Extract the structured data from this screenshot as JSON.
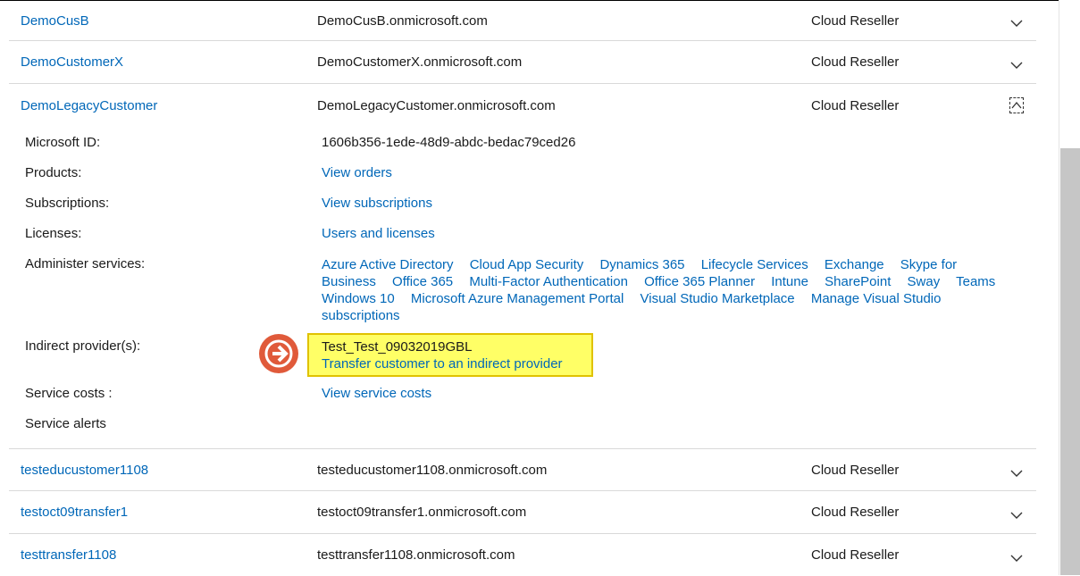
{
  "customers_above": [
    {
      "name": "DemoCusB",
      "domain": "DemoCusB.onmicrosoft.com",
      "relationship": "Cloud Reseller"
    },
    {
      "name": "DemoCustomerX",
      "domain": "DemoCustomerX.onmicrosoft.com",
      "relationship": "Cloud Reseller"
    }
  ],
  "expanded": {
    "name": "DemoLegacyCustomer",
    "domain": "DemoLegacyCustomer.onmicrosoft.com",
    "relationship": "Cloud Reseller",
    "microsoft_id_label": "Microsoft ID:",
    "microsoft_id": "1606b356-1ede-48d9-abdc-bedac79ced26",
    "products_label": "Products:",
    "products_link": "View orders",
    "subscriptions_label": "Subscriptions:",
    "subscriptions_link": "View subscriptions",
    "licenses_label": "Licenses:",
    "licenses_link": "Users and licenses",
    "administer_label": "Administer services:",
    "services": [
      "Azure Active Directory",
      "Cloud App Security",
      "Dynamics 365",
      "Lifecycle Services",
      "Exchange",
      "Skype for Business",
      "Office 365",
      "Multi-Factor Authentication",
      "Office 365 Planner",
      "Intune",
      "SharePoint",
      "Sway",
      "Teams",
      "Windows 10",
      "Microsoft Azure Management Portal",
      "Visual Studio Marketplace",
      "Manage Visual Studio subscriptions"
    ],
    "indirect_label": "Indirect provider(s):",
    "indirect_provider": "Test_Test_09032019GBL",
    "indirect_transfer_link": "Transfer customer to an indirect provider",
    "service_costs_label": "Service costs :",
    "service_costs_link": "View service costs",
    "service_alerts_label": "Service alerts"
  },
  "customers_below": [
    {
      "name": "testeducustomer1108",
      "domain": "testeducustomer1108.onmicrosoft.com",
      "relationship": "Cloud Reseller"
    },
    {
      "name": "testoct09transfer1",
      "domain": "testoct09transfer1.onmicrosoft.com",
      "relationship": "Cloud Reseller"
    },
    {
      "name": "testtransfer1108",
      "domain": "testtransfer1108.onmicrosoft.com",
      "relationship": "Cloud Reseller"
    }
  ],
  "colors": {
    "link": "#0067b8",
    "highlight": "#ffff66",
    "arrow": "#e05a3a"
  },
  "icons": {
    "expand": "chevron-down-icon",
    "collapse": "chevron-up-icon",
    "callout": "arrow-right-icon"
  }
}
